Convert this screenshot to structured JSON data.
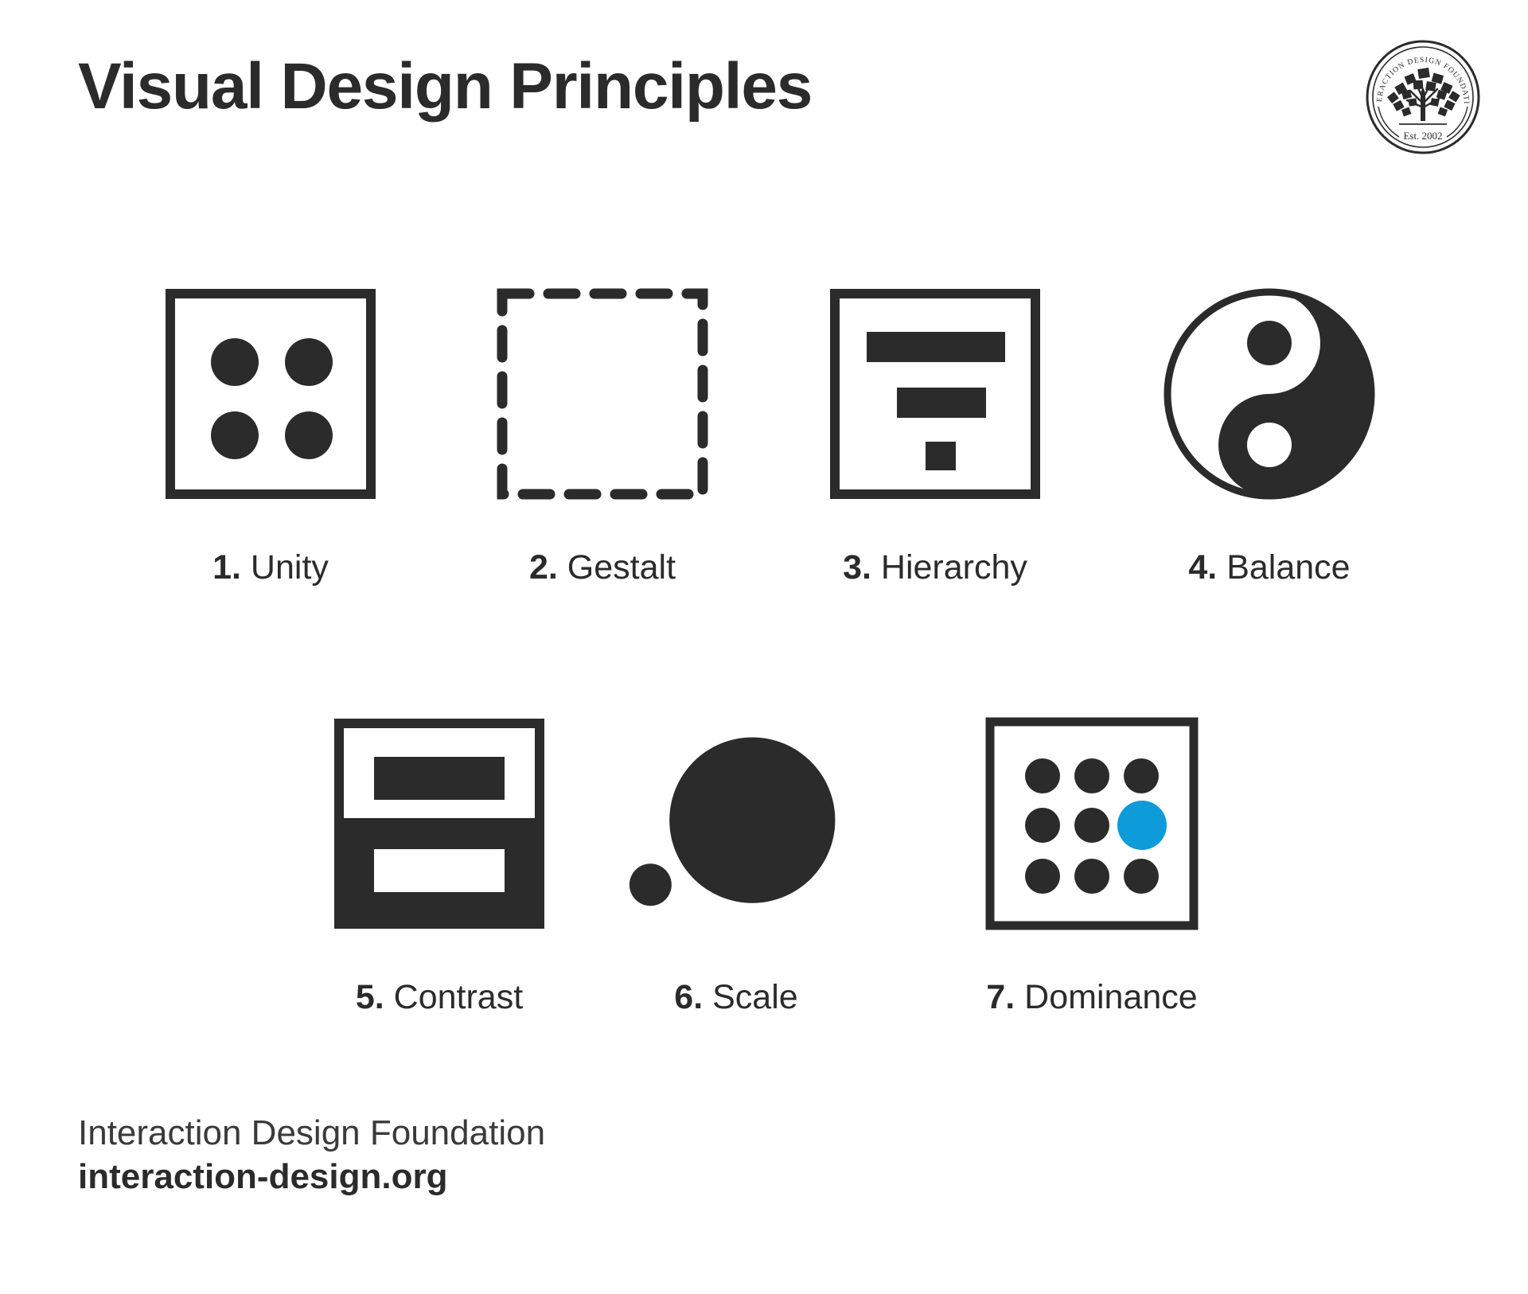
{
  "header": {
    "title": "Visual Design Principles",
    "logo": {
      "arc_text": "INTERACTION DESIGN FOUNDATION",
      "established": "Est. 2002",
      "icon": "tree-seal-logo"
    }
  },
  "colors": {
    "ink": "#2b2b2b",
    "accent_blue": "#0e9bd9",
    "background": "#ffffff"
  },
  "principles": [
    {
      "num": "1.",
      "label": "Unity",
      "icon": "square-four-dots-icon"
    },
    {
      "num": "2.",
      "label": "Gestalt",
      "icon": "dashed-square-icon"
    },
    {
      "num": "3.",
      "label": "Hierarchy",
      "icon": "stacked-bars-square-icon"
    },
    {
      "num": "4.",
      "label": "Balance",
      "icon": "yin-yang-icon"
    },
    {
      "num": "5.",
      "label": "Contrast",
      "icon": "inverted-halves-square-icon"
    },
    {
      "num": "6.",
      "label": "Scale",
      "icon": "two-circles-icon"
    },
    {
      "num": "7.",
      "label": "Dominance",
      "icon": "nine-dots-one-blue-icon"
    }
  ],
  "footer": {
    "organization": "Interaction Design Foundation",
    "url": "interaction-design.org"
  }
}
